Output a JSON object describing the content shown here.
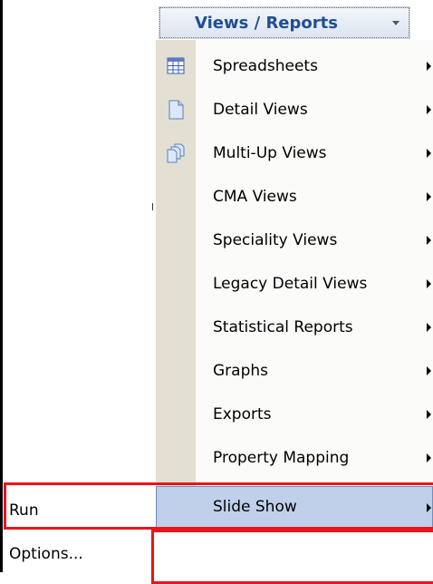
{
  "header": {
    "title": "Views / Reports",
    "caret_icon": "chevron-down-icon"
  },
  "menu": {
    "items": [
      {
        "label": "Spreadsheets",
        "icon": "spreadsheet-grid-icon"
      },
      {
        "label": "Detail Views",
        "icon": "document-icon"
      },
      {
        "label": "Multi-Up Views",
        "icon": "multiple-documents-icon"
      },
      {
        "label": "CMA Views",
        "icon": ""
      },
      {
        "label": "Speciality Views",
        "icon": ""
      },
      {
        "label": "Legacy Detail Views",
        "icon": ""
      },
      {
        "label": "Statistical Reports",
        "icon": ""
      },
      {
        "label": "Graphs",
        "icon": ""
      },
      {
        "label": "Exports",
        "icon": ""
      },
      {
        "label": "Property Mapping",
        "icon": ""
      },
      {
        "label": "Slide Show",
        "icon": "",
        "selected": true
      }
    ]
  },
  "submenu": {
    "items": [
      {
        "label": "Run"
      },
      {
        "label": "Options..."
      }
    ]
  },
  "colors": {
    "header_text": "#1f4e93",
    "selected_bg": "#c0d0ea",
    "gutter": "#e3dfd2",
    "highlight_red": "#e8151b"
  }
}
